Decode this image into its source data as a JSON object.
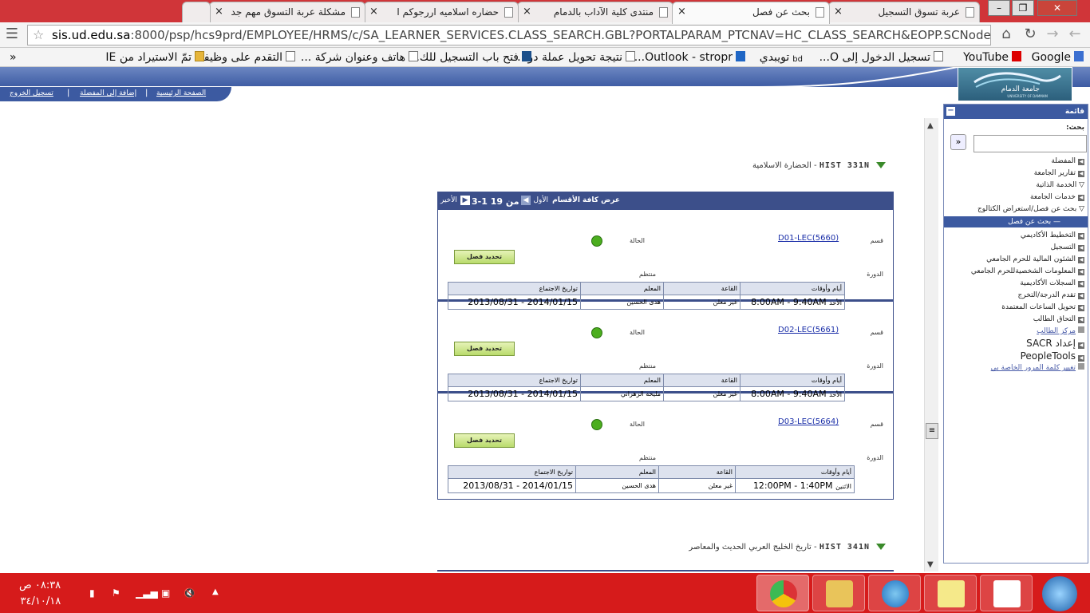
{
  "browser": {
    "tabs": [
      {
        "title": "عربة تسوق التسجيل",
        "active": false
      },
      {
        "title": "بحث عن فصل",
        "active": true
      },
      {
        "title": "منتدى كلية الآداب بالدمام",
        "active": false
      },
      {
        "title": "حضاره اسلاميه اررجوكم ا",
        "active": false
      },
      {
        "title": "مشكلة عربة التسوق مهم جد",
        "active": false
      }
    ],
    "url_host": "sis.ud.edu.sa",
    "url_rest": ":8000/psp/hcs9prd/EMPLOYEE/HRMS/c/SA_LEARNER_SERVICES.CLASS_SEARCH.GBL?PORTALPARAM_PTCNAV=HC_CLASS_SEARCH&EOPP.SCNode=HR",
    "bookmarks": [
      "Google",
      "YouTube",
      "تسجيل الدخول إلى O...",
      "تويبدي",
      "Outlook - stropr...",
      "نتيجة تحويل عملة دو...",
      "فتح باب التسجيل للك...",
      "هاتف وعنوان شركة ...",
      "التقدم على وظيفة",
      "تمّ الاستيراد من IE"
    ],
    "bookmarks_more": "»"
  },
  "header": {
    "nav_home": "الصفحة الرئيسية",
    "nav_fav": "إضافة إلى المفضلة",
    "nav_logout": "تسجيل الخروج",
    "logo_text": "جامعة الدمام",
    "logo_sub": "UNIVERSITY OF DAMMAM"
  },
  "main": {
    "course1_code": "HIST 331N",
    "course1_name": "- الحضارة الاسلامية",
    "course2_code": "HIST 341N",
    "course2_name": "- تاريخ الخليج العربي الحديث والمعاصر",
    "grid": {
      "view_all": "عرض كافة الأقسام",
      "first": "الأول",
      "range": "3-1 من 19",
      "last": "الأخير"
    },
    "labels": {
      "section": "قسم",
      "status": "الحالة",
      "session": "الدورة",
      "session_val": "منتظم",
      "select": "تحديد فصل"
    },
    "meet_headers": [
      "أيام وأوقات",
      "القاعة",
      "المعلم",
      "تواريخ الاجتماع"
    ],
    "sections": [
      {
        "link": "D01-LEC(5660)",
        "days": "الأحد",
        "time": "8:00AM - 9:40AM",
        "room": "غير معلن",
        "instructor": "هدى الحسين",
        "dates": "2013/08/31 - 2014/01/15"
      },
      {
        "link": "D02-LEC(5661)",
        "days": "الأحد",
        "time": "8:00AM - 9:40AM",
        "room": "غير معلن",
        "instructor": "مليحه الزهراني",
        "dates": "2013/08/31 - 2014/01/15"
      },
      {
        "link": "D03-LEC(5664)",
        "days": "الاثنين",
        "time": "12:00PM - 1:40PM",
        "room": "غير معلن",
        "instructor": "هدى الحسين",
        "dates": "2013/08/31 - 2014/01/15"
      }
    ]
  },
  "menu": {
    "title": "قائمة",
    "search_label": "بحث:",
    "items": [
      {
        "label": "المفضلة",
        "type": "arrow"
      },
      {
        "label": "تقارير الجامعة",
        "type": "arrow"
      },
      {
        "label": "الخدمة الذاتية",
        "type": "open"
      },
      {
        "label": "خدمات الجامعة",
        "type": "arrow"
      },
      {
        "label": "بحث عن فصل/استعراض الكتالوج",
        "type": "open"
      },
      {
        "label": "— بحث عن فصل",
        "type": "hl"
      },
      {
        "label": "التخطيط الأكاديمي",
        "type": "arrow"
      },
      {
        "label": "التسجيل",
        "type": "arrow"
      },
      {
        "label": "الشئون المالية للحرم الجامعي",
        "type": "arrow"
      },
      {
        "label": "المعلومات الشخصيةللحرم الجامعي",
        "type": "arrow"
      },
      {
        "label": "السجلات الأكاديمية",
        "type": "arrow"
      },
      {
        "label": "تقدم الدرجة/التخرج",
        "type": "arrow"
      },
      {
        "label": "تحويل الساعات المعتمدة",
        "type": "arrow"
      },
      {
        "label": "التحاق الطالب",
        "type": "arrow"
      },
      {
        "label": "مركز الطالب",
        "type": "link"
      },
      {
        "label": "إعداد SACR",
        "type": "arrow"
      },
      {
        "label": "PeopleTools",
        "type": "arrow"
      },
      {
        "label": "تغيير كلمة المرور الخاصة بي",
        "type": "link"
      }
    ]
  },
  "taskbar": {
    "time": "٠٨:٣٨ ص",
    "date": "٣٤/١٠/١٨"
  },
  "colors": {
    "ps_blue": "#3c5aa1",
    "grid_blue": "#3c4f8a",
    "tab_red": "#d03539",
    "taskbar_red": "#d61b1b",
    "status_green": "#4cae1f"
  }
}
